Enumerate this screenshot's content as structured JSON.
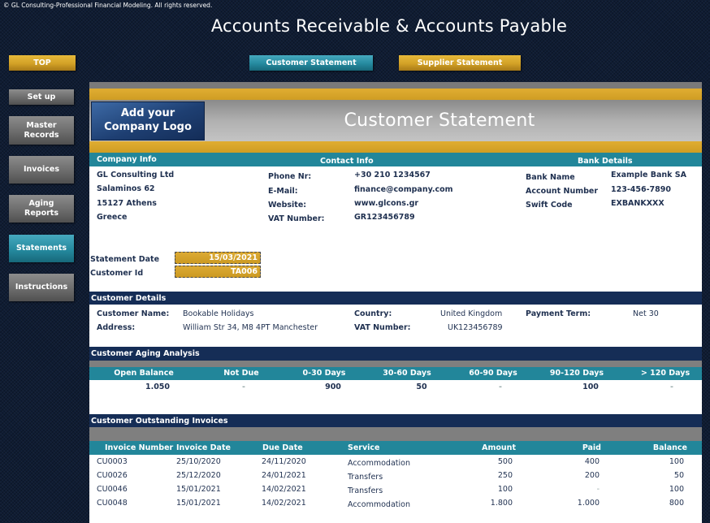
{
  "copyright": "© GL Consulting-Professional Financial Modeling. All rights reserved.",
  "app_title": "Accounts Receivable & Accounts Payable",
  "top_nav": {
    "top": "TOP",
    "customer_statement": "Customer Statement",
    "supplier_statement": "Supplier Statement"
  },
  "sidebar": {
    "items": [
      {
        "label": "Set up"
      },
      {
        "label": "Master Records"
      },
      {
        "label": "Invoices"
      },
      {
        "label": "Aging Reports"
      },
      {
        "label": "Statements",
        "active": true
      },
      {
        "label": "Instructions"
      }
    ]
  },
  "colors": {
    "gold": "#d2a126",
    "teal": "#22869a",
    "navy": "#152d56",
    "gray": "#7f7f7f",
    "background": "#0f1c33"
  },
  "header": {
    "logo_line1": "Add your",
    "logo_line2": "Company Logo",
    "title": "Customer Statement"
  },
  "company_info": {
    "heading": "Company Info",
    "lines": [
      "GL Consulting Ltd",
      "Salaminos 62",
      "15127 Athens",
      "Greece"
    ]
  },
  "contact_info": {
    "heading": "Contact Info",
    "fields": [
      {
        "label": "Phone Nr:",
        "value": "+30 210 1234567"
      },
      {
        "label": "E-Mail:",
        "value": "finance@company.com"
      },
      {
        "label": "Website:",
        "value": "www.glcons.gr"
      },
      {
        "label": "VAT Number:",
        "value": "GR123456789"
      }
    ]
  },
  "bank_details": {
    "heading": "Bank Details",
    "fields": [
      {
        "label": "Bank Name",
        "value": "Example Bank SA"
      },
      {
        "label": "Account Number",
        "value": "123-456-7890"
      },
      {
        "label": "Swift Code",
        "value": "EXBANKXXX"
      }
    ]
  },
  "statement": {
    "date_label": "Statement Date",
    "date_value": "15/03/2021",
    "customer_id_label": "Customer Id",
    "customer_id_value": "TA006"
  },
  "customer_details": {
    "heading": "Customer Details",
    "name_label": "Customer Name:",
    "name_value": "Bookable Holidays",
    "address_label": "Address:",
    "address_value": "William Str 34, M8 4PT  Manchester",
    "country_label": "Country:",
    "country_value": "United Kingdom",
    "vat_label": "VAT Number:",
    "vat_value": "UK123456789",
    "payment_term_label": "Payment Term:",
    "payment_term_value": "Net 30"
  },
  "aging": {
    "heading": "Customer Aging Analysis",
    "columns": [
      "Open Balance",
      "Not Due",
      "0-30 Days",
      "30-60 Days",
      "60-90 Days",
      "90-120 Days",
      "> 120 Days"
    ],
    "values": [
      "1.050",
      "-",
      "900",
      "50",
      "-",
      "100",
      "-"
    ]
  },
  "invoices": {
    "heading": "Customer Outstanding Invoices",
    "columns": [
      "Invoice Number",
      "Invoice Date",
      "Due Date",
      "Service",
      "Amount",
      "Paid",
      "Balance"
    ],
    "rows": [
      [
        "CU0003",
        "25/10/2020",
        "24/11/2020",
        "Accommodation",
        "500",
        "400",
        "100"
      ],
      [
        "CU0026",
        "25/12/2020",
        "24/01/2021",
        "Transfers",
        "250",
        "200",
        "50"
      ],
      [
        "CU0046",
        "15/01/2021",
        "14/02/2021",
        "Transfers",
        "100",
        "-",
        "100"
      ],
      [
        "CU0048",
        "15/01/2021",
        "14/02/2021",
        "Accommodation",
        "1.800",
        "1.000",
        "800"
      ]
    ]
  }
}
